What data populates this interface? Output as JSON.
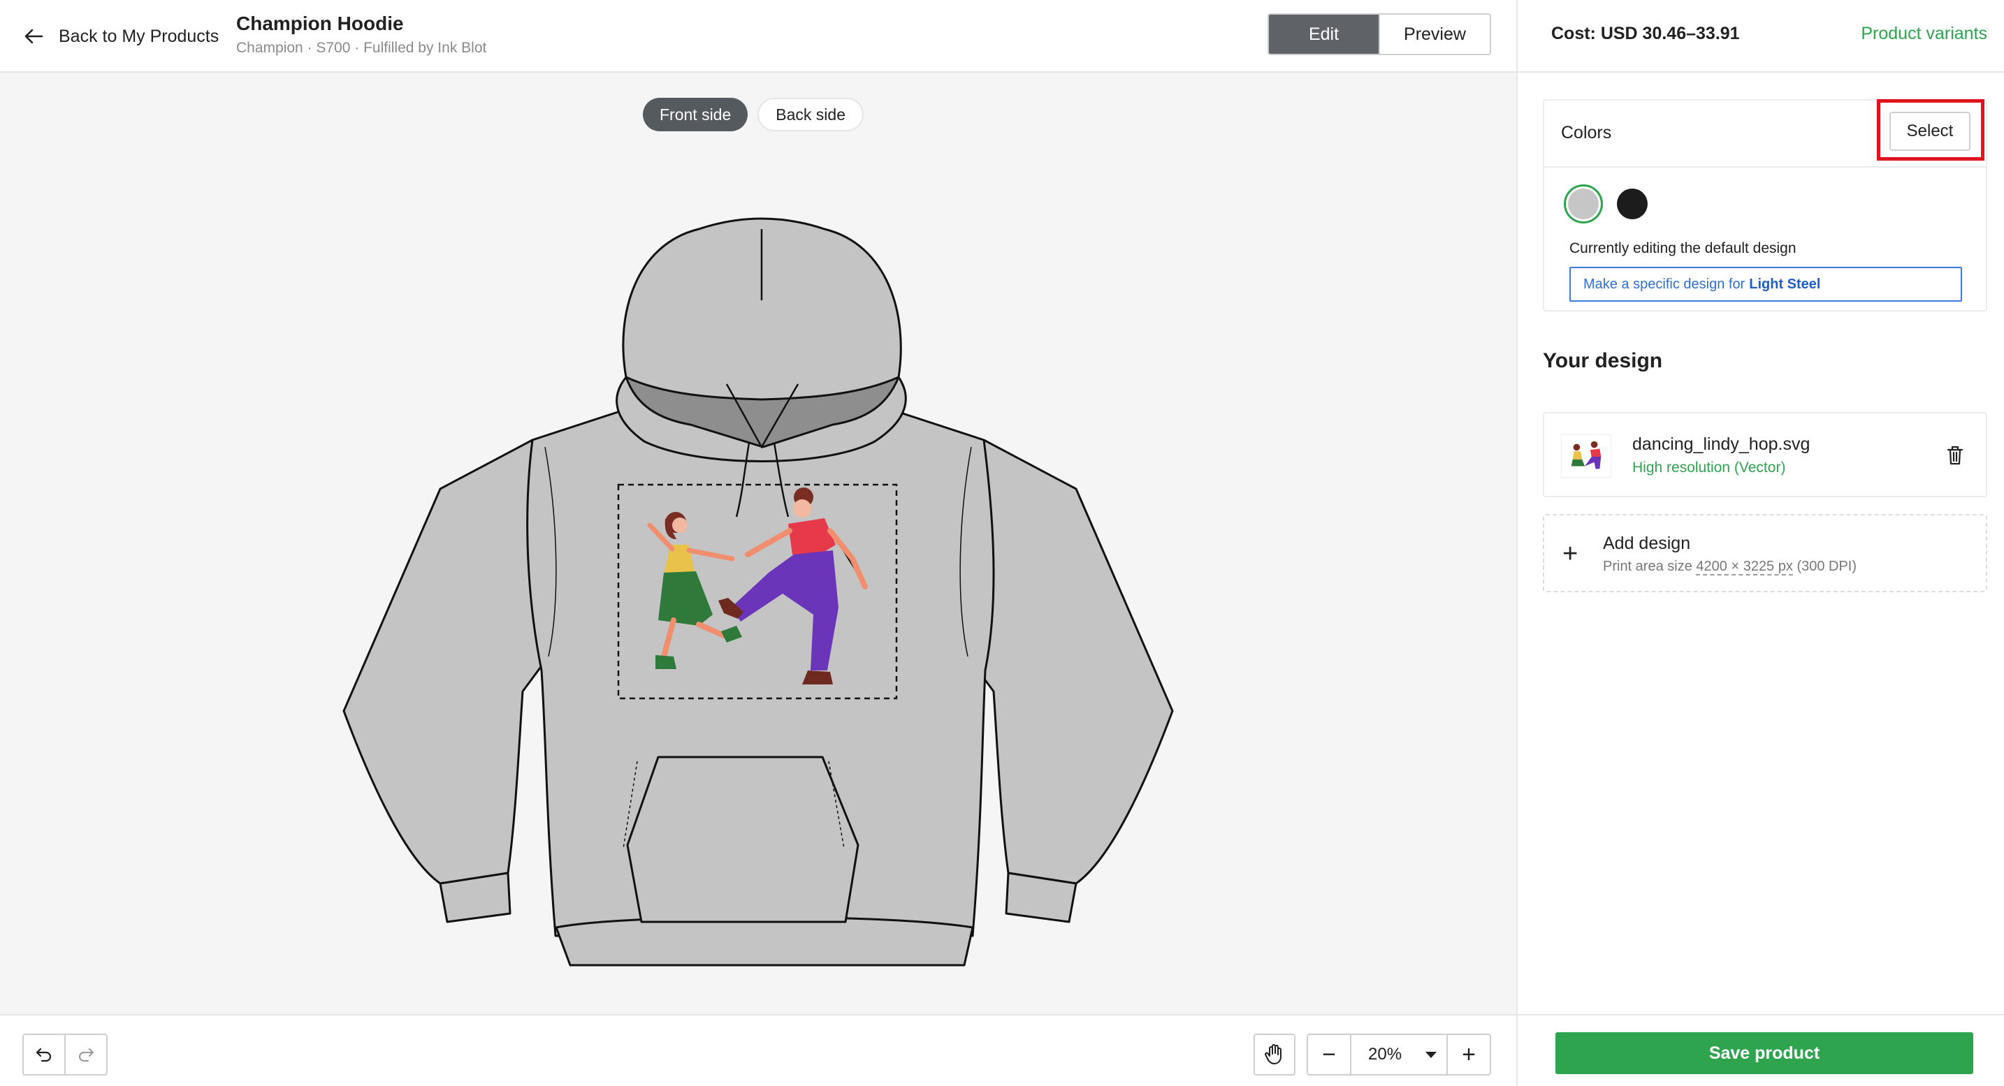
{
  "header": {
    "back_label": "Back to My Products",
    "product_title": "Champion Hoodie",
    "product_subtitle": "Champion · S700 · Fulfilled by Ink Blot",
    "modes": {
      "edit": "Edit",
      "preview": "Preview",
      "active": "Edit"
    }
  },
  "canvas": {
    "sides": {
      "front": "Front side",
      "back": "Back side",
      "active": "Front side"
    },
    "garment_color": "#c4c4c4",
    "garment_icon": "hoodie-mockup"
  },
  "toolbar": {
    "undo_icon": "undo-icon",
    "redo_icon": "redo-icon",
    "hand_icon": "hand-icon",
    "zoom_value": "20%",
    "zoom_out": "−",
    "zoom_in": "+"
  },
  "panel": {
    "cost": "Cost: USD 30.46–33.91",
    "variants_link": "Product variants",
    "colors": {
      "label": "Colors",
      "select_label": "Select",
      "swatches": [
        {
          "name": "Light Steel",
          "hex": "#c6c6c6",
          "selected": true
        },
        {
          "name": "Black",
          "hex": "#1c1c1c",
          "selected": false
        }
      ],
      "editing_text": "Currently editing the default design",
      "specific_prefix": "Make a specific design for",
      "specific_color": "Light Steel"
    },
    "your_design_title": "Your design",
    "file": {
      "name": "dancing_lindy_hop.svg",
      "resolution": "High resolution (Vector)"
    },
    "add_design": {
      "title": "Add design",
      "print_prefix": "Print area size",
      "dimensions": "4200 × 3225 px",
      "dpi": "(300 DPI)"
    },
    "save_label": "Save product"
  },
  "colors": {
    "accent_green": "#2ea44f",
    "highlight_red": "#e0141e",
    "link_blue": "#2f6fd1"
  }
}
